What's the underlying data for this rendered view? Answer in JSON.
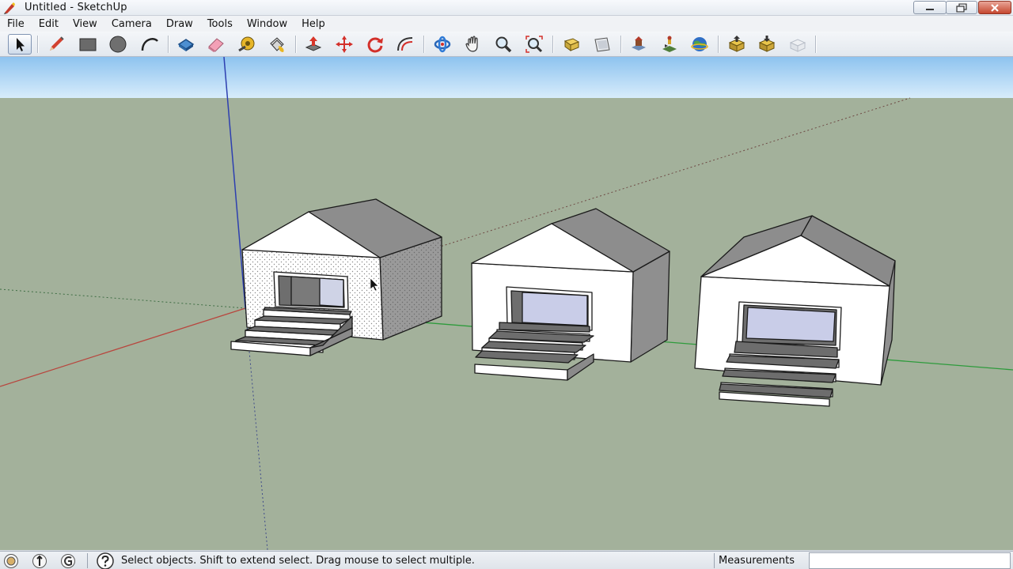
{
  "window": {
    "title": "Untitled - SketchUp"
  },
  "menu": {
    "items": [
      "File",
      "Edit",
      "View",
      "Camera",
      "Draw",
      "Tools",
      "Window",
      "Help"
    ]
  },
  "toolbar": {
    "tools": [
      "select-icon",
      "pencil-icon",
      "rectangle-icon",
      "circle-icon",
      "arc-icon",
      "make-component-icon",
      "eraser-icon",
      "tape-measure-icon",
      "paint-bucket-icon",
      "push-pull-icon",
      "move-icon",
      "rotate-icon",
      "offset-icon",
      "orbit-icon",
      "pan-icon",
      "zoom-icon",
      "zoom-extents-icon",
      "previous-view-icon",
      "next-view-icon",
      "place-model-icon",
      "get-models-icon",
      "google-earth-icon",
      "share-model-icon",
      "share-component-icon",
      "component-warehouse-icon"
    ],
    "active_tool": "select-icon"
  },
  "statusbar": {
    "hint": "Select objects. Shift to extend select. Drag mouse to select multiple.",
    "measurements_label": "Measurements",
    "measurements_value": ""
  },
  "colors": {
    "sky_top": "#8ec3ef",
    "sky_bottom": "#d7ecfb",
    "ground": "#a3b19b",
    "red_axis": "#b8463e",
    "green_axis": "#2e9b3c",
    "blue_axis": "#2d3fb0"
  }
}
